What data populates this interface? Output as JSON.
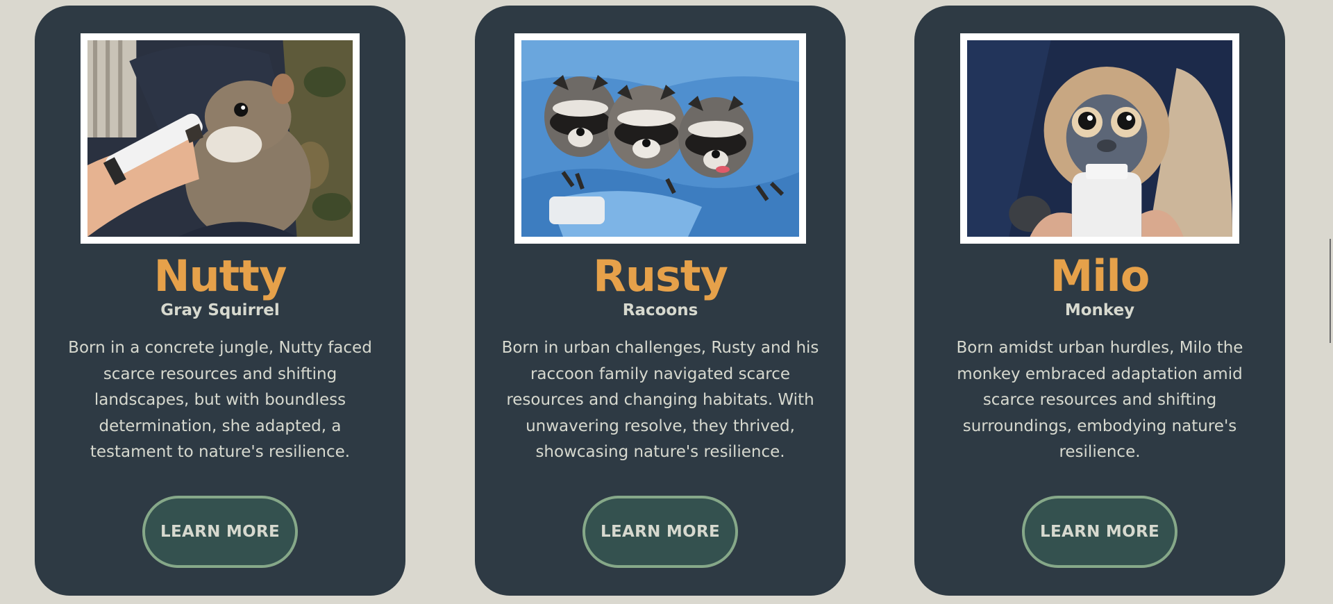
{
  "cards": [
    {
      "name": "Nutty",
      "species": "Gray Squirrel",
      "description": "Born in a concrete jungle, Nutty faced scarce resources and shifting landscapes, but with boundless determination, she adapted, a testament to nature's resilience.",
      "button_label": "LEARN MORE",
      "photo_icon": "squirrel-photo"
    },
    {
      "name": "Rusty",
      "species": "Racoons",
      "description": "Born in urban challenges, Rusty and his raccoon family navigated scarce resources and changing habitats. With unwavering resolve, they thrived, showcasing nature's resilience.",
      "button_label": "LEARN MORE",
      "photo_icon": "raccoons-photo"
    },
    {
      "name": "Milo",
      "species": "Monkey",
      "description": "Born amidst urban hurdles, Milo the monkey embraced adaptation amid scarce resources and shifting surroundings, embodying nature's resilience.",
      "button_label": "LEARN MORE",
      "photo_icon": "monkey-photo"
    }
  ],
  "colors": {
    "background": "#dad8cf",
    "card": "#2e3a44",
    "name": "#e6a14a",
    "text": "#d7d9cf",
    "button_fill": "#34514f",
    "button_border": "#86a889"
  }
}
